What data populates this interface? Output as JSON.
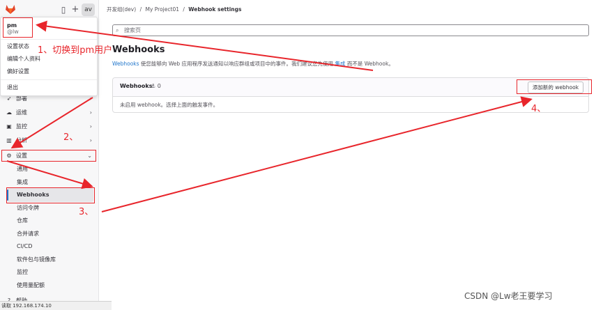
{
  "topbar": {
    "avatar_text": "av",
    "sidebar_toggle_icon": "sidebar-icon",
    "plus_icon": "plus-icon"
  },
  "user_menu": {
    "name": "pm",
    "handle": "@lw",
    "items": [
      "设置状态",
      "编辑个人资料",
      "偏好设置"
    ],
    "signout": "退出"
  },
  "sidebar": {
    "items": [
      {
        "label": "部署",
        "icon": "rocket-icon"
      },
      {
        "label": "运维",
        "icon": "cloud-icon"
      },
      {
        "label": "监控",
        "icon": "monitor-icon"
      },
      {
        "label": "分析",
        "icon": "chart-icon"
      }
    ],
    "settings_label": "设置",
    "sub_items": [
      "通用",
      "集成",
      "Webhooks",
      "访问令牌",
      "仓库",
      "合并请求",
      "CI/CD",
      "软件包与镜像库",
      "监控",
      "使用量配额"
    ],
    "help_label": "帮助"
  },
  "breadcrumb": {
    "group": "开发组(dev)",
    "project": "My Project01",
    "current": "Webhook settings",
    "sep": "/"
  },
  "search": {
    "placeholder": "搜索页"
  },
  "page": {
    "title": "Webhooks",
    "desc_link": "Webhooks",
    "desc_mid": " 使您能够向 Web 应用程序发送通知以响应群组或项目中的事件。我们建议您先使用 ",
    "desc_link2": "集成",
    "desc_end": " 而不是 Webhook。"
  },
  "webhooks_card": {
    "title": "Webhooks",
    "count": "0",
    "add_button": "添加新的 webhook",
    "empty_text": "未启用 webhook。选择上面的触发事件。"
  },
  "status_bar": "读取 192.168.174.10",
  "annotations": {
    "a1": "1、切换到pm用户",
    "a2": "2、",
    "a3": "3、",
    "a4": "4、"
  },
  "watermark": "CSDN @Lw老王要学习",
  "colors": {
    "annotation": "#e8252b",
    "link": "#1f75cb",
    "active_bar": "#1f75cb"
  }
}
